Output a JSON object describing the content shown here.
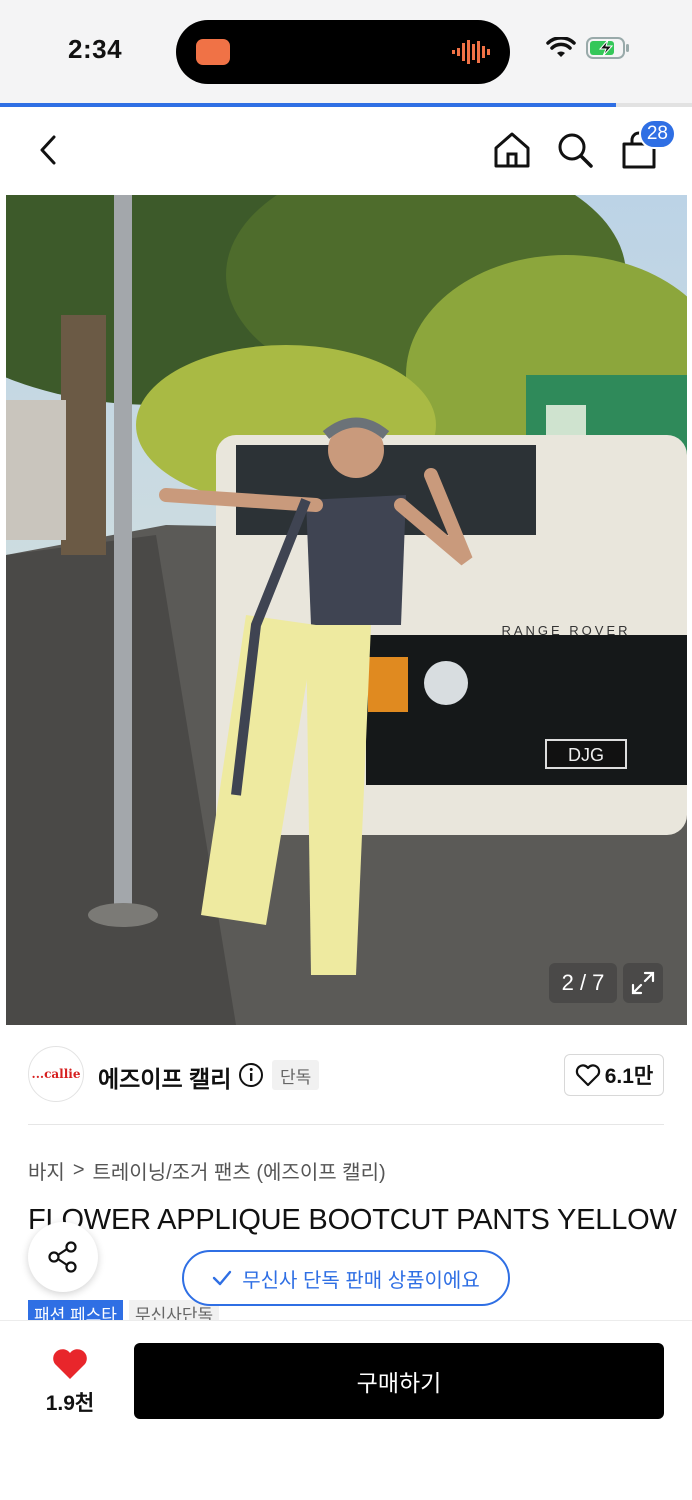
{
  "status": {
    "time": "2:34"
  },
  "page_progress": 0.89,
  "header": {
    "cart_count": "28"
  },
  "image": {
    "counter": "2 / 7"
  },
  "brand": {
    "logo_text": "...callie",
    "name": "에즈이프 캘리",
    "exclusive_tag": "단독",
    "likes": "6.1만"
  },
  "breadcrumb": {
    "category": "바지",
    "separator": ">",
    "subcategory": "트레이닝/조거 팬츠 (에즈이프 캘리)"
  },
  "product": {
    "title": "FLOWER APPLIQUE BOOTCUT PANTS YELLOW"
  },
  "notice": {
    "text": "무신사 단독 판매 상품이에요"
  },
  "tags": {
    "festival": "패션 페스타",
    "exclusive": "무신사단독"
  },
  "bottom": {
    "wish_count": "1.9천",
    "buy_label": "구매하기"
  },
  "colors": {
    "accent": "#2f6fe4",
    "heart": "#e8262b",
    "buy_bg": "#000000"
  },
  "icons": [
    "back-icon",
    "home-icon",
    "search-icon",
    "cart-icon",
    "expand-icon",
    "info-icon",
    "heart-outline-icon",
    "share-icon",
    "check-icon",
    "heart-filled-icon",
    "wifi-icon",
    "battery-icon"
  ]
}
